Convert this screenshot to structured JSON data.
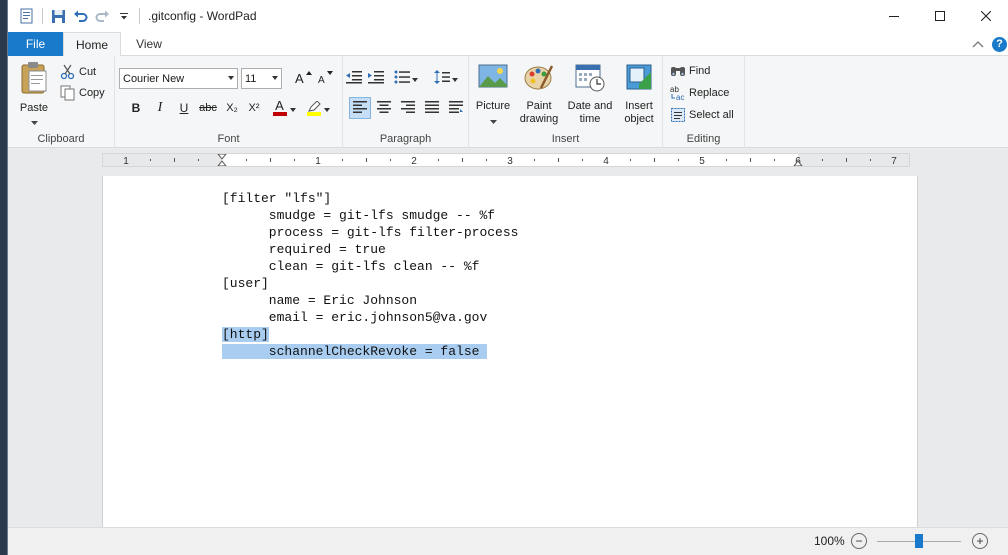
{
  "window": {
    "title": ".gitconfig - WordPad"
  },
  "tabs": {
    "file": "File",
    "home": "Home",
    "view": "View"
  },
  "ribbon": {
    "clipboard": {
      "label": "Clipboard",
      "paste": "Paste",
      "cut": "Cut",
      "copy": "Copy"
    },
    "font": {
      "label": "Font",
      "family": "Courier New",
      "size": "11",
      "bold": "B",
      "italic": "I",
      "underline": "U",
      "strikethrough": "abc",
      "subscript": "X₂",
      "superscript": "X²",
      "font_color_glyph": "A",
      "font_color": "#c00000",
      "highlight_color": "#ffff00"
    },
    "paragraph": {
      "label": "Paragraph"
    },
    "insert": {
      "label": "Insert",
      "picture": "Picture",
      "paint_line1": "Paint",
      "paint_line2": "drawing",
      "datetime_line1": "Date and",
      "datetime_line2": "time",
      "object_line1": "Insert",
      "object_line2": "object"
    },
    "editing": {
      "label": "Editing",
      "find": "Find",
      "replace": "Replace",
      "select_all": "Select all"
    }
  },
  "ruler": {
    "numbers": [
      "1",
      "1",
      "2",
      "3",
      "4",
      "5",
      "6",
      "7"
    ]
  },
  "document": {
    "lines": [
      {
        "text": "[filter \"lfs\"]",
        "selected": false
      },
      {
        "text": "      smudge = git-lfs smudge -- %f",
        "selected": false
      },
      {
        "text": "      process = git-lfs filter-process",
        "selected": false
      },
      {
        "text": "      required = true",
        "selected": false
      },
      {
        "text": "      clean = git-lfs clean -- %f",
        "selected": false
      },
      {
        "text": "[user]",
        "selected": false
      },
      {
        "text": "      name = Eric Johnson",
        "selected": false
      },
      {
        "text": "      email = eric.johnson5@va.gov",
        "selected": false
      },
      {
        "text": "[http]",
        "selected": true
      },
      {
        "text": "      schannelCheckRevoke = false ",
        "selected": true
      }
    ]
  },
  "status": {
    "zoom": "100%",
    "zoom_out": "−",
    "zoom_in": "+",
    "zoom_level": 0.5
  },
  "colors": {
    "accent": "#1979ca",
    "selection": "#a9cdf0",
    "ribbon_bg": "#f5f6f7"
  }
}
